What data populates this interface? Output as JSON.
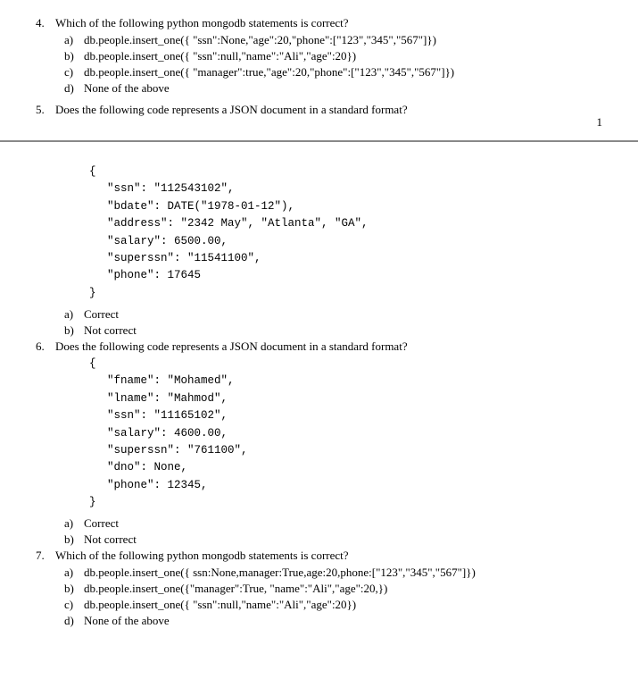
{
  "page": {
    "number": "1",
    "top_section": {
      "q4": {
        "num": "4.",
        "text": "Which of the following python mongodb statements is correct?",
        "options": [
          {
            "letter": "a)",
            "text": "db.people.insert_one({ \"ssn\":None,\"age\":20,\"phone\":[\"123\",\"345\",\"567\"]})"
          },
          {
            "letter": "b)",
            "text": "db.people.insert_one({ \"ssn\":null,\"name\":\"Ali\",\"age\":20})"
          },
          {
            "letter": "c)",
            "text": "db.people.insert_one({ \"manager\":true,\"age\":20,\"phone\":[\"123\",\"345\",\"567\"]})"
          },
          {
            "letter": "d)",
            "text": "None of the above"
          }
        ]
      },
      "q5": {
        "num": "5.",
        "text": "Does the following code represents a JSON document in a standard format?"
      }
    },
    "bottom_section": {
      "q5_code": [
        "{",
        "    \"ssn\": \"112543102\",",
        "    \"bdate\": DATE(\"1978-01-12\"),",
        "    \"address\": \"2342 May\", \"Atlanta\", \"GA\",",
        "    \"salary\": 6500.00,",
        "    \"superssn\": \"11541100\",",
        "    \"phone\": 17645",
        "}"
      ],
      "q5_options": [
        {
          "letter": "a)",
          "text": "Correct"
        },
        {
          "letter": "b)",
          "text": "Not correct"
        }
      ],
      "q6": {
        "num": "6.",
        "text": "Does the following code represents a JSON document in a standard format?",
        "code": [
          "{",
          "    \"fname\": \"Mohamed\",",
          "    \"lname\": \"Mahmod\",",
          "    \"ssn\": \"11165102\",",
          "    \"salary\": 4600.00,",
          "    \"superssn\": \"761100\",",
          "    \"dno\": None,",
          "    \"phone\": 12345,",
          "}"
        ],
        "options": [
          {
            "letter": "a)",
            "text": "Correct"
          },
          {
            "letter": "b)",
            "text": "Not correct"
          }
        ]
      },
      "q7": {
        "num": "7.",
        "text": "Which of the following python mongodb statements is correct?",
        "options": [
          {
            "letter": "a)",
            "text": "db.people.insert_one({ ssn:None,manager:True,age:20,phone:[\"123\",\"345\",\"567\"]})"
          },
          {
            "letter": "b)",
            "text": "db.people.insert_one({\"manager\":True, \"name\":\"Ali\",\"age\":20,})"
          },
          {
            "letter": "c)",
            "text": "db.people.insert_one({ \"ssn\":null,\"name\":\"Ali\",\"age\":20})"
          },
          {
            "letter": "d)",
            "text": "None of the above"
          }
        ]
      }
    }
  }
}
